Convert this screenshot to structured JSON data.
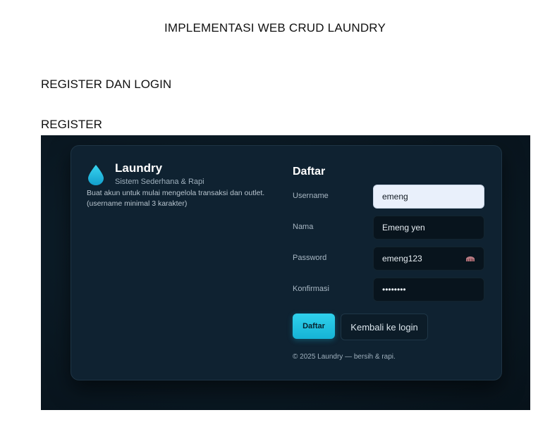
{
  "document": {
    "title": "IMPLEMENTASI WEB CRUD LAUNDRY",
    "section_main": "REGISTER DAN LOGIN",
    "section_sub": "REGISTER"
  },
  "app": {
    "brand_name": "Laundry",
    "brand_tagline": "Sistem Sederhana & Rapi",
    "description": "Buat akun untuk mulai mengelola transaksi dan outlet. (username minimal 3 karakter)",
    "form_title": "Daftar",
    "fields": [
      {
        "label": "Username",
        "value": "emeng"
      },
      {
        "label": "Nama",
        "value": "Emeng yen"
      },
      {
        "label": "Password",
        "value": "emeng123"
      },
      {
        "label": "Konfirmasi",
        "value": "••••••••"
      }
    ],
    "submit_label": "Daftar",
    "back_label": "Kembali ke login",
    "footer": "© 2025 Laundry — bersih & rapi.",
    "colors": {
      "accent": "#1fc2e2",
      "card_bg": "#0f2231",
      "page_bg": "#0a1822"
    },
    "icons": {
      "brand": "water-drop-icon",
      "password_toggle": "eye-off-icon"
    }
  }
}
